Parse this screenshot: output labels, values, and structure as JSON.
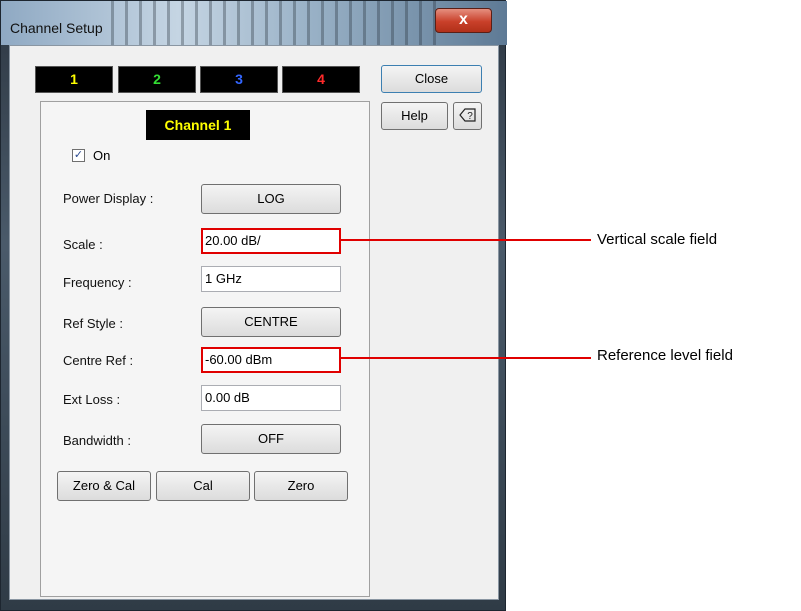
{
  "window": {
    "title": "Channel Setup",
    "close_glyph": "x"
  },
  "channel_tabs": [
    {
      "label": "1",
      "color": "#ffff00"
    },
    {
      "label": "2",
      "color": "#33dd33"
    },
    {
      "label": "3",
      "color": "#3366ff"
    },
    {
      "label": "4",
      "color": "#ff2a2a"
    }
  ],
  "side_buttons": {
    "close_label": "Close",
    "help_label": "Help",
    "context_help_icon": "help-cursor-icon"
  },
  "panel": {
    "channel_label": "Channel 1",
    "on_checked": true,
    "on_label": "On",
    "power_display_label": "Power Display :",
    "power_display_value": "LOG",
    "scale_label": "Scale :",
    "scale_value": "20.00 dB/",
    "frequency_label": "Frequency :",
    "frequency_value": "1 GHz",
    "ref_style_label": "Ref Style :",
    "ref_style_value": "CENTRE",
    "centre_ref_label": "Centre Ref :",
    "centre_ref_value": "-60.00 dBm",
    "ext_loss_label": "Ext Loss :",
    "ext_loss_value": "0.00 dB",
    "bandwidth_label": "Bandwidth :",
    "bandwidth_value": "OFF",
    "zero_cal_label": "Zero & Cal",
    "cal_label": "Cal",
    "zero_label": "Zero"
  },
  "annotations": {
    "scale_callout": "Vertical scale field",
    "ref_callout": "Reference level field",
    "highlight_color": "#e00000"
  }
}
